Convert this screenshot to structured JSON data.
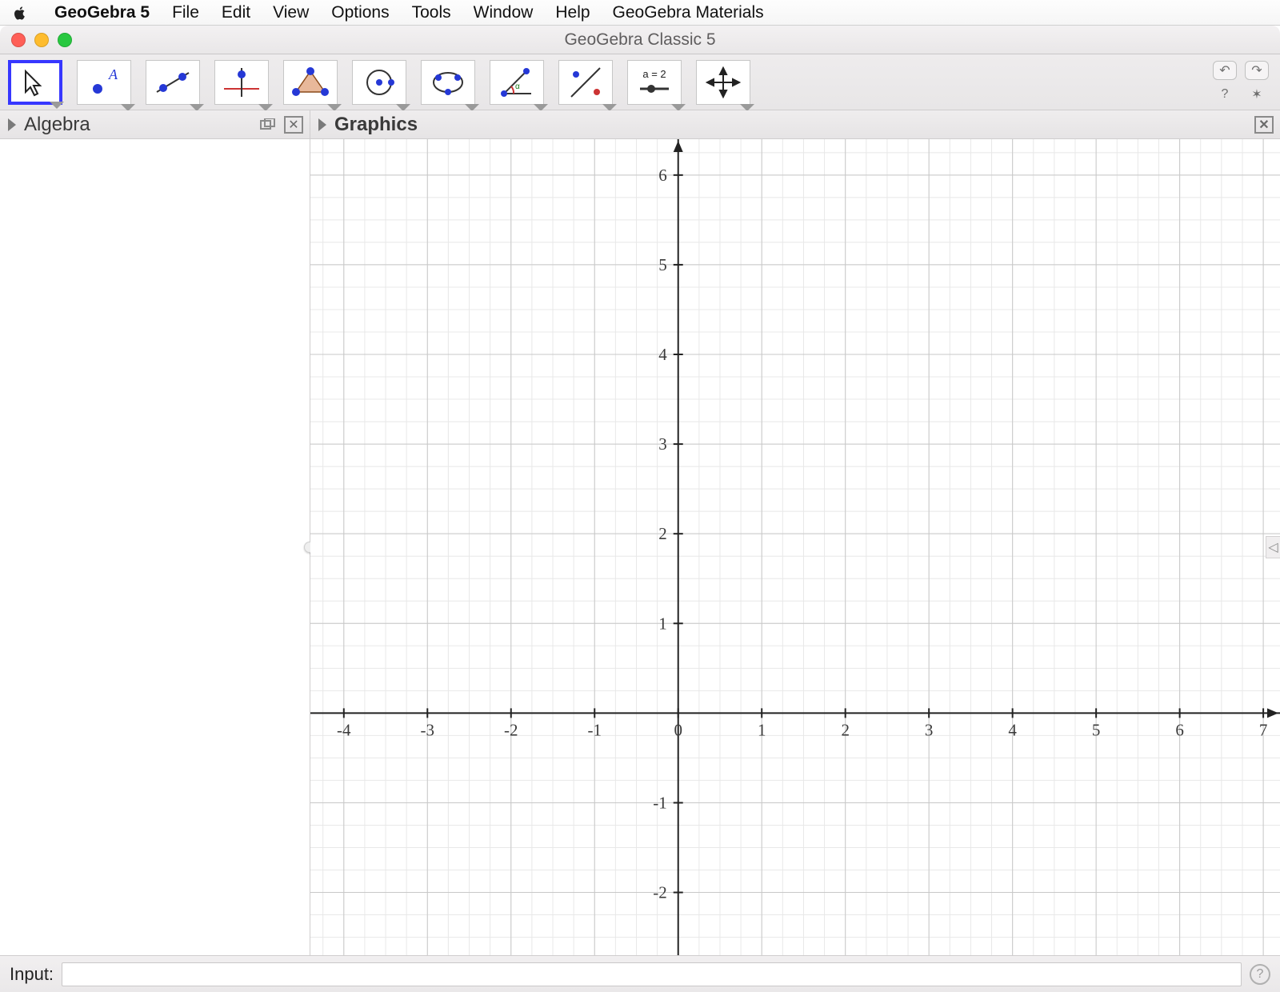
{
  "menubar": {
    "app": "GeoGebra 5",
    "items": [
      "File",
      "Edit",
      "View",
      "Options",
      "Tools",
      "Window",
      "Help",
      "GeoGebra Materials"
    ]
  },
  "window": {
    "title": "GeoGebra Classic 5"
  },
  "toolbar": {
    "tools": [
      {
        "name": "move-tool",
        "selected": true
      },
      {
        "name": "point-tool"
      },
      {
        "name": "line-tool"
      },
      {
        "name": "perpendicular-tool"
      },
      {
        "name": "polygon-tool"
      },
      {
        "name": "circle-tool"
      },
      {
        "name": "ellipse-tool"
      },
      {
        "name": "angle-tool"
      },
      {
        "name": "reflect-tool"
      },
      {
        "name": "slider-tool",
        "label": "a = 2"
      },
      {
        "name": "move-graphics-tool"
      }
    ]
  },
  "panels": {
    "algebra": "Algebra",
    "graphics": "Graphics"
  },
  "input": {
    "label": "Input:",
    "value": ""
  },
  "chart_data": {
    "type": "scatter",
    "title": "",
    "xlabel": "",
    "ylabel": "",
    "x_ticks": [
      -4,
      -3,
      -2,
      -1,
      0,
      1,
      2,
      3,
      4,
      5,
      6,
      7
    ],
    "y_ticks": [
      -2,
      -1,
      1,
      2,
      3,
      4,
      5,
      6
    ],
    "xlim": [
      -4.4,
      7.2
    ],
    "ylim": [
      -2.7,
      6.4
    ],
    "series": []
  }
}
